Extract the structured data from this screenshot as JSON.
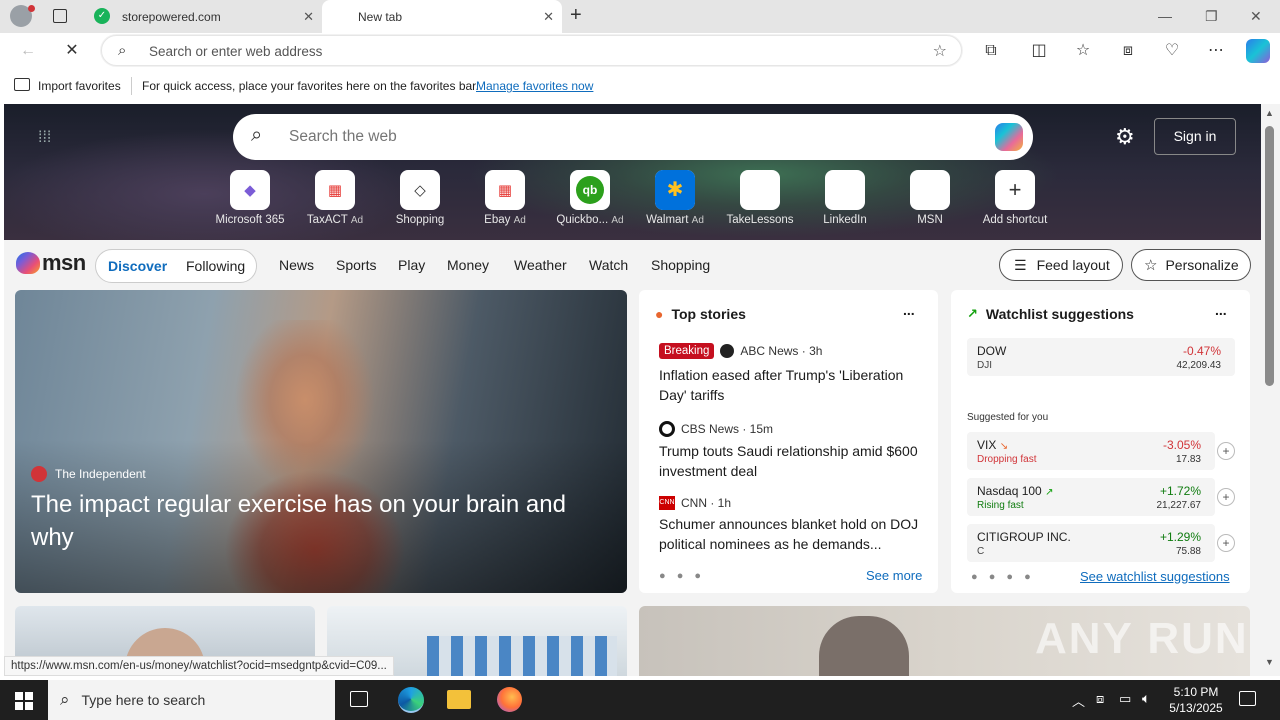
{
  "browser": {
    "tabs": [
      {
        "title": "storepowered.com",
        "active": false
      },
      {
        "title": "New tab",
        "active": true
      }
    ],
    "new_tab_icon": "plus-icon",
    "address_placeholder": "Search or enter web address",
    "favorites_bar": {
      "import_label": "Import favorites",
      "message": "For quick access, place your favorites here on the favorites bar.",
      "manage_link": "Manage favorites now"
    },
    "status_url": "https://www.msn.com/en-us/money/watchlist?ocid=msedgntp&cvid=C09..."
  },
  "newtab": {
    "search_placeholder": "Search the web",
    "sign_in": "Sign in",
    "shortcuts": [
      {
        "label": "Microsoft 365",
        "ad": "",
        "glyph": "◆",
        "color": "#7b5cd6"
      },
      {
        "label": "TaxACT",
        "ad": "Ad",
        "glyph": "▦",
        "color": "#e53935"
      },
      {
        "label": "Shopping",
        "ad": "",
        "glyph": "◇",
        "color": "#333333"
      },
      {
        "label": "Ebay",
        "ad": "Ad",
        "glyph": "▦",
        "color": "#e53935"
      },
      {
        "label": "Quickbo...",
        "ad": "Ad",
        "glyph": "qb",
        "color": "#2ca01c"
      },
      {
        "label": "Walmart",
        "ad": "Ad",
        "glyph": "✱",
        "color": "#0071dc"
      },
      {
        "label": "TakeLessons",
        "ad": "",
        "glyph": "",
        "color": "#ffffff"
      },
      {
        "label": "LinkedIn",
        "ad": "",
        "glyph": "",
        "color": "#ffffff"
      },
      {
        "label": "MSN",
        "ad": "",
        "glyph": "",
        "color": "#ffffff"
      },
      {
        "label": "Add shortcut",
        "ad": "",
        "glyph": "+",
        "color": "#333333"
      }
    ],
    "msn_logo": "msn",
    "toggle": {
      "discover": "Discover",
      "following": "Following"
    },
    "nav": [
      "News",
      "Sports",
      "Play",
      "Money",
      "Weather",
      "Watch",
      "Shopping"
    ],
    "feed_layout": "Feed layout",
    "personalize": "Personalize",
    "main_story": {
      "source": "The Independent",
      "title": "The impact regular exercise has on your brain and why"
    },
    "top_stories": {
      "heading": "Top stories",
      "more": "...",
      "items": [
        {
          "badge": "Breaking",
          "source": "ABC News · 3h",
          "title": "Inflation eased after Trump's 'Liberation Day' tariffs"
        },
        {
          "badge": "",
          "source": "CBS News · 15m",
          "title": "Trump touts Saudi relationship amid $600 investment deal"
        },
        {
          "badge": "",
          "source": "CNN · 1h",
          "title": "Schumer announces blanket hold on DOJ political nominees as he demands..."
        }
      ],
      "see_more": "See more"
    },
    "watchlist": {
      "heading": "Watchlist suggestions",
      "more": "...",
      "dow": {
        "name": "DOW",
        "symbol": "DJI",
        "change": "-0.47%",
        "value": "42,209.43"
      },
      "suggested_label": "Suggested for you",
      "items": [
        {
          "name": "VIX",
          "sub": "Dropping fast",
          "change": "-3.05%",
          "value": "17.83",
          "dir": "down"
        },
        {
          "name": "Nasdaq 100",
          "sub": "Rising fast",
          "change": "+1.72%",
          "value": "21,227.67",
          "dir": "up"
        },
        {
          "name": "CITIGROUP INC.",
          "sub": "C",
          "change": "+1.29%",
          "value": "75.88",
          "dir": "up"
        }
      ],
      "see_link": "See watchlist suggestions"
    },
    "watermark": "ANY RUN"
  },
  "taskbar": {
    "search_placeholder": "Type here to search",
    "time": "5:10 PM",
    "date": "5/13/2025"
  },
  "colors": {
    "accent": "#0f6cbd",
    "red": "#d13438",
    "green": "#107c10",
    "breaking": "#c50f1f"
  }
}
